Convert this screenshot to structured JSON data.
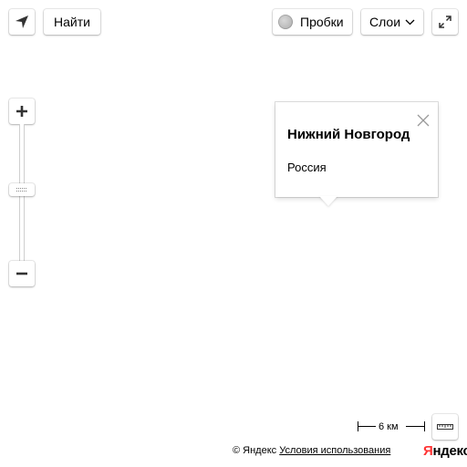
{
  "toolbar": {
    "search_label": "Найти",
    "traffic_label": "Пробки",
    "layers_label": "Слои"
  },
  "icons": {
    "geolocation": "arrow-navigation-icon",
    "traffic": "traffic-light-icon",
    "layers_dropdown": "chevron-down-icon",
    "fullscreen": "expand-icon",
    "zoom_in": "plus-icon",
    "zoom_out": "minus-icon",
    "zoom_handle": "grip-icon",
    "ruler": "ruler-icon",
    "close": "close-icon"
  },
  "balloon": {
    "title": "Нижний Новгород",
    "subtitle": "Россия"
  },
  "scale": {
    "label": "6 км"
  },
  "footer": {
    "copyright": "© Яндекс",
    "terms": "Условия использования"
  },
  "logo": {
    "first_letter": "Я",
    "rest": "ндекс"
  },
  "colors": {
    "logo_accent": "#ff3333",
    "traffic_indicator": "#b0b0b0"
  }
}
